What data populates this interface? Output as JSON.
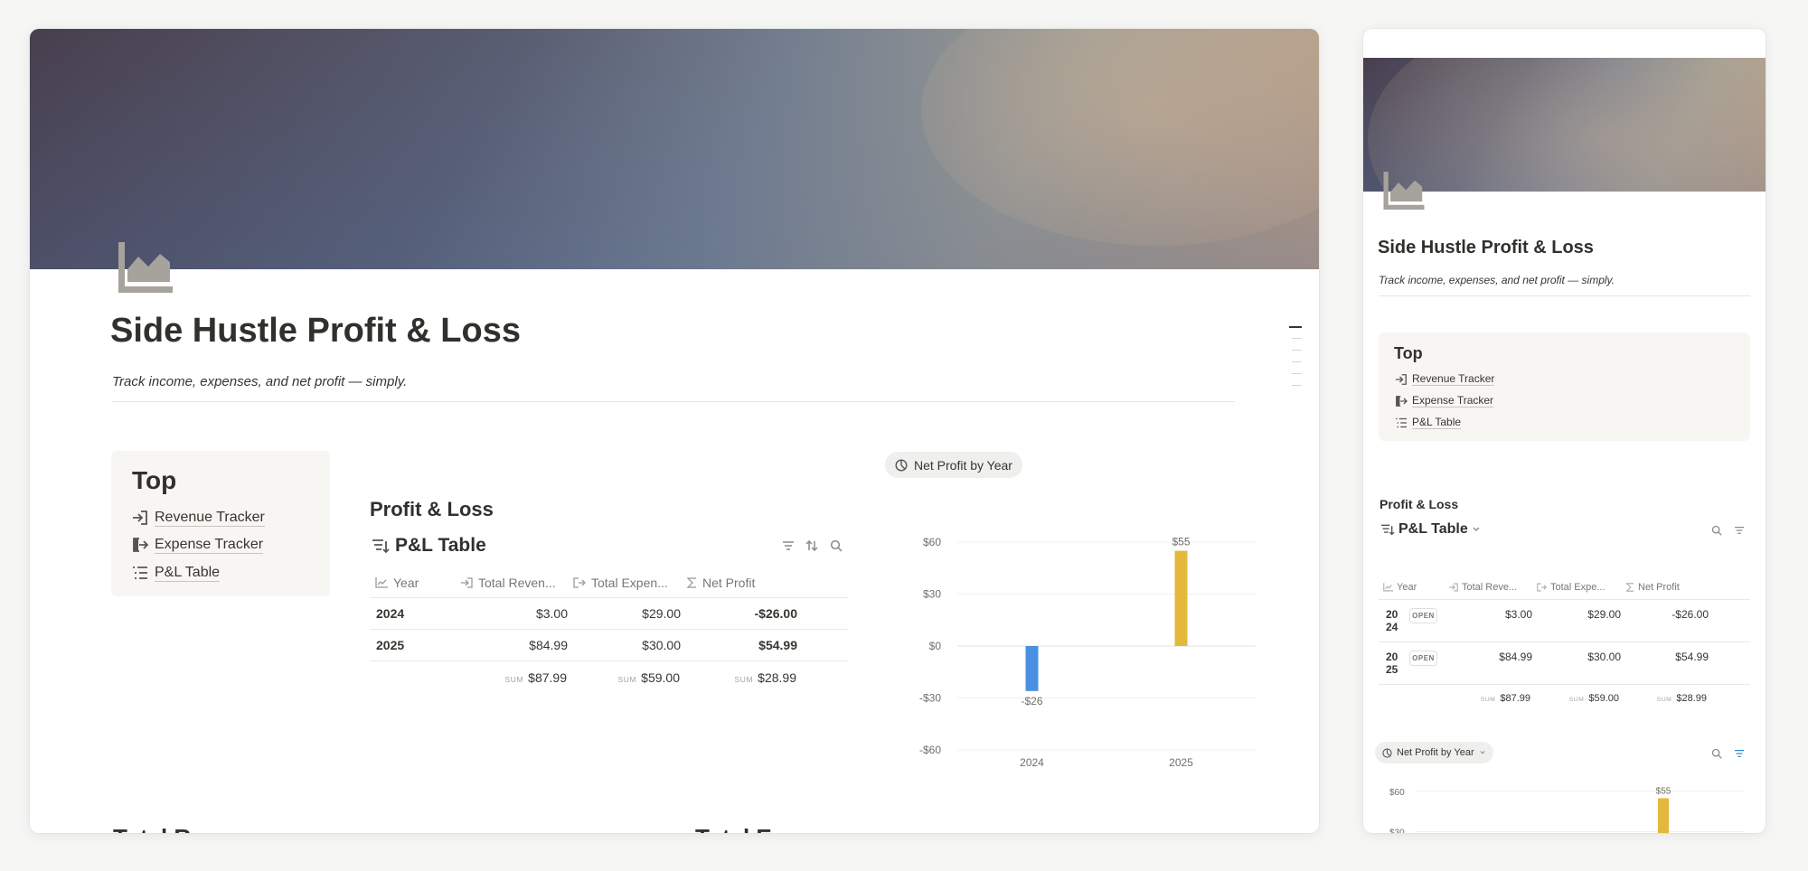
{
  "page": {
    "title": "Side Hustle Profit & Loss",
    "subtitle": "Track income, expenses, and net profit — simply.",
    "icon": "area-chart-icon"
  },
  "toc": {
    "heading": "Top",
    "items": [
      {
        "label": "Revenue Tracker",
        "icon": "sign-in-icon"
      },
      {
        "label": "Expense Tracker",
        "icon": "sign-out-icon"
      },
      {
        "label": "P&L Table",
        "icon": "list-icon"
      }
    ]
  },
  "section": {
    "heading": "Profit & Loss"
  },
  "table": {
    "title": "P&L Table",
    "columns": [
      "Year",
      "Total Reven...",
      "Total Expen...",
      "Net Profit"
    ],
    "columns_mobile": [
      "Year",
      "Total Reve...",
      "Total Expe...",
      "Net Profit"
    ],
    "rows": [
      {
        "year": "2024",
        "year_top": "20",
        "year_bottom": "24",
        "revenue": "$3.00",
        "expenses": "$29.00",
        "net": "-$26.00"
      },
      {
        "year": "2025",
        "year_top": "20",
        "year_bottom": "25",
        "revenue": "$84.99",
        "expenses": "$30.00",
        "net": "$54.99"
      }
    ],
    "open_label": "OPEN",
    "sum_label": "SUM",
    "sums": {
      "revenue": "$87.99",
      "expenses": "$59.00",
      "net": "$28.99"
    }
  },
  "chart_view": {
    "label": "Net Profit by Year"
  },
  "chart_data": {
    "type": "bar",
    "categories": [
      "2024",
      "2025"
    ],
    "values": [
      -26,
      55
    ],
    "data_labels": [
      "-$26",
      "$55"
    ],
    "ylim": [
      -60,
      60
    ],
    "yticks": [
      "$60",
      "$30",
      "$0",
      "-$30",
      "-$60"
    ],
    "ytick_values": [
      60,
      30,
      0,
      -30,
      -60
    ],
    "colors": [
      "#4a90e2",
      "#e4b83c"
    ],
    "grid": true
  },
  "mobile_chart": {
    "yticks": [
      "$60",
      "$30"
    ],
    "ytick_values": [
      60,
      30
    ],
    "data_label": "$55"
  },
  "next_section": {
    "left_cut": "Total R",
    "right_cut": "Total E"
  }
}
